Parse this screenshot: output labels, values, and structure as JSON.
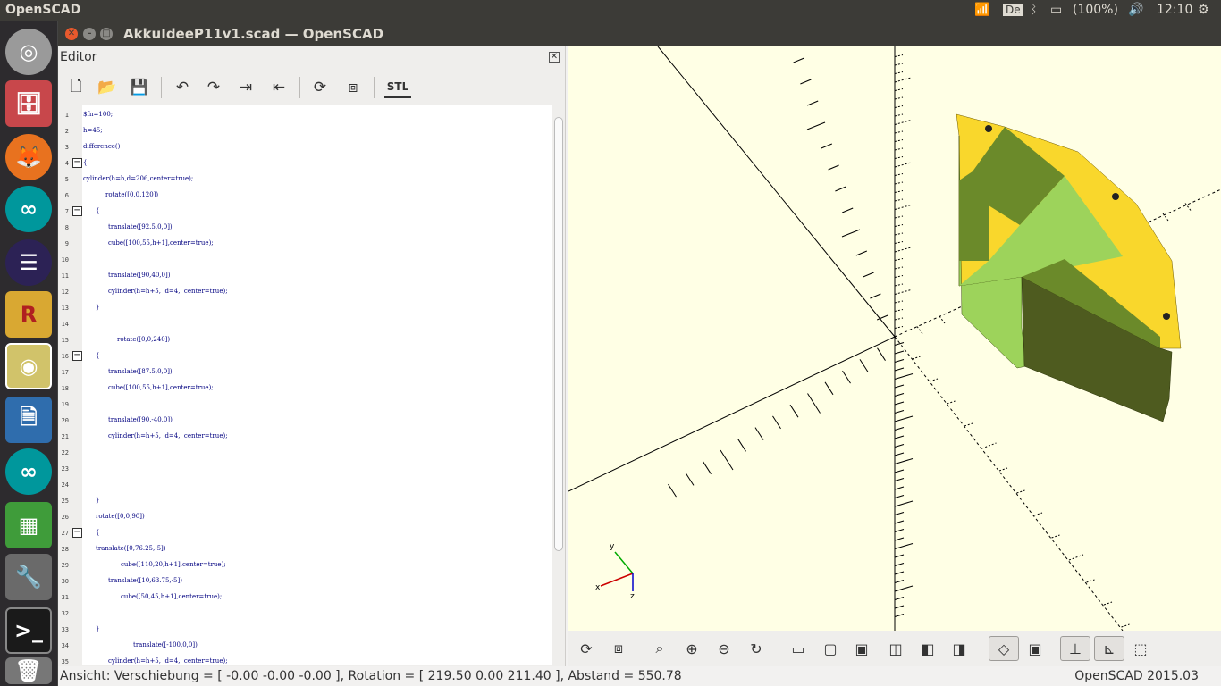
{
  "topbar": {
    "app_name": "OpenSCAD",
    "keyboard": "De",
    "battery": "(100%)",
    "time": "12:10"
  },
  "window": {
    "title": "AkkuIdeeP11v1.scad — OpenSCAD"
  },
  "editor": {
    "title": "Editor",
    "close": "⊠",
    "toolbar": {
      "new": "🗋",
      "open": "📂",
      "save": "💾",
      "undo": "↶",
      "redo": "↷",
      "indent": "⇥",
      "unindent": "⇤",
      "preview": "⟳",
      "render": "⧈",
      "stl": "STL"
    },
    "lines": [
      {
        "n": "1",
        "t": "$fn=100;"
      },
      {
        "n": "2",
        "t": "h=45;"
      },
      {
        "n": "3",
        "t": "difference()"
      },
      {
        "n": "4",
        "t": "{"
      },
      {
        "n": "5",
        "t": "cylinder(h=h,d=206,center=true);"
      },
      {
        "n": "6",
        "t": "rotate([0,0,120])"
      },
      {
        "n": "7",
        "t": "{"
      },
      {
        "n": "8",
        "t": "translate([92.5,0,0])"
      },
      {
        "n": "9",
        "t": "cube([100,55,h+1],center=true);"
      },
      {
        "n": "10",
        "t": ""
      },
      {
        "n": "11",
        "t": "translate([90,40,0])"
      },
      {
        "n": "12",
        "t": "cylinder(h=h+5,  d=4,  center=true);"
      },
      {
        "n": "13",
        "t": "}"
      },
      {
        "n": "14",
        "t": ""
      },
      {
        "n": "15",
        "t": "rotate([0,0,240])"
      },
      {
        "n": "16",
        "t": "{"
      },
      {
        "n": "17",
        "t": "translate([87.5,0,0])"
      },
      {
        "n": "18",
        "t": "cube([100,55,h+1],center=true);"
      },
      {
        "n": "19",
        "t": ""
      },
      {
        "n": "20",
        "t": "translate([90,-40,0])"
      },
      {
        "n": "21",
        "t": "cylinder(h=h+5,  d=4,  center=true);"
      },
      {
        "n": "22",
        "t": ""
      },
      {
        "n": "23",
        "t": ""
      },
      {
        "n": "24",
        "t": ""
      },
      {
        "n": "25",
        "t": "}"
      },
      {
        "n": "26",
        "t": "rotate([0,0,90])"
      },
      {
        "n": "27",
        "t": "{"
      },
      {
        "n": "28",
        "t": "translate([0,76.25,-5])"
      },
      {
        "n": "29",
        "t": "cube([110,20,h+1],center=true);"
      },
      {
        "n": "30",
        "t": "translate([10,63.75,-5])"
      },
      {
        "n": "31",
        "t": "cube([50,45,h+1],center=true);"
      },
      {
        "n": "32",
        "t": ""
      },
      {
        "n": "33",
        "t": "}"
      },
      {
        "n": "34",
        "t": "translate([-100,0,0])"
      },
      {
        "n": "35",
        "t": "cylinder(h=h+5,  d=4,  center=true);"
      }
    ]
  },
  "viewport": {
    "axis_x": "x",
    "axis_y": "y",
    "axis_z": "z",
    "colors": {
      "background": "#ffffe5",
      "top_face": "#f9d72c",
      "side_face": "#9dd35b",
      "dark_face": "#4e5b1f"
    }
  },
  "view_toolbar": {
    "preview": "⟳",
    "render": "⧈",
    "view_all": "⌕",
    "zoom_in": "⊕",
    "zoom_out": "⊖",
    "reset": "↻",
    "right": "▭",
    "top": "▢",
    "bottom": "▣",
    "left": "◫",
    "front": "◧",
    "back": "◨",
    "perspective": "◇",
    "orthogonal": "▣",
    "axes": "⊥",
    "scale": "⊾",
    "edges": "⬚"
  },
  "status": {
    "left": "Ansicht: Verschiebung = [ -0.00 -0.00 -0.00 ], Rotation = [ 219.50 0.00 211.40 ], Abstand = 550.78",
    "right": "OpenSCAD 2015.03"
  }
}
